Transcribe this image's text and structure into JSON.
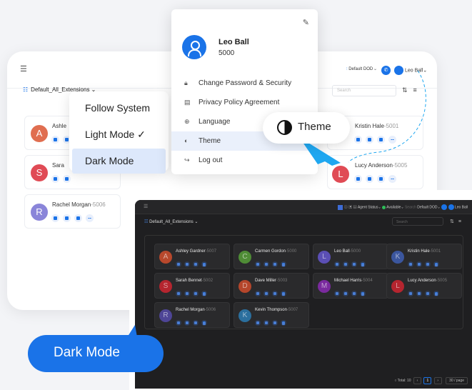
{
  "colors": {
    "accent": "#1a73e8",
    "dark_bg": "#1f1f21",
    "light_bg": "#ffffff",
    "status_green": "#2ebd59"
  },
  "light_window": {
    "menu_icon": "menu-icon",
    "search_top_placeholder": "Search",
    "dod": "Default DOD",
    "user": "Leo Ball",
    "extension_group": "Default_All_Extensions",
    "search_placeholder": "Search",
    "cards": [
      {
        "initial": "A",
        "name": "Ashle",
        "ext": "",
        "color": "#e06e50"
      },
      {
        "initial": "S",
        "name": "Sara",
        "ext": "",
        "color": "#e04b55"
      },
      {
        "initial": "R",
        "name": "Rachel Morgan",
        "ext": "-5006",
        "color": "#8a85d9"
      },
      {
        "initial": "",
        "name": "Kristin Hale",
        "ext": "-5001",
        "color": "#7b8ee6"
      },
      {
        "initial": "L",
        "name": "Lucy Anderson",
        "ext": "-5005",
        "color": "#e04b55"
      }
    ]
  },
  "theme_menu": {
    "items": [
      "Follow System",
      "Light Mode ✓",
      "Dark Mode"
    ],
    "selected_index": 2
  },
  "profile_menu": {
    "name": "Leo Ball",
    "number": "5000",
    "items": [
      {
        "label": "Change Password & Security",
        "icon": "lock-icon"
      },
      {
        "label": "Privacy Policy Agreement",
        "icon": "document-icon"
      },
      {
        "label": "Language",
        "icon": "globe-icon"
      },
      {
        "label": "Theme",
        "icon": "theme-icon"
      },
      {
        "label": "Log out",
        "icon": "logout-icon"
      }
    ],
    "selected_index": 3
  },
  "theme_bubble": {
    "label": "Theme"
  },
  "dark_window": {
    "agent_status": "Agent Status",
    "available": "Available",
    "search_top_placeholder": "Search",
    "dod": "Default DOD",
    "user": "Leo Ball",
    "extension_group": "Default_All_Extensions",
    "search_placeholder": "Search",
    "cards": [
      {
        "initial": "A",
        "name": "Ashley Gardner",
        "ext": "-5007",
        "color": "#b8482c"
      },
      {
        "initial": "C",
        "name": "Carmen Gordon",
        "ext": "-5000",
        "color": "#4f8c36"
      },
      {
        "initial": "L",
        "name": "Leo Ball",
        "ext": "-5000",
        "color": "#5b4fb5"
      },
      {
        "initial": "K",
        "name": "Kristin Hale",
        "ext": "-5001",
        "color": "#3b569e"
      },
      {
        "initial": "S",
        "name": "Sarah Bennet",
        "ext": "-5002",
        "color": "#b5252f"
      },
      {
        "initial": "D",
        "name": "Dave Miller",
        "ext": "-5003",
        "color": "#b5462b"
      },
      {
        "initial": "M",
        "name": "Michael Harris",
        "ext": "-5004",
        "color": "#7a2a9e"
      },
      {
        "initial": "L",
        "name": "Lucy Anderson",
        "ext": "-5005",
        "color": "#b5252f"
      },
      {
        "initial": "R",
        "name": "Rachel Morgan",
        "ext": "-5006",
        "color": "#4e4596"
      },
      {
        "initial": "K",
        "name": "Kevin Thompson",
        "ext": "-5007",
        "color": "#2b6f9e"
      }
    ],
    "footer": {
      "total": "Total: 10",
      "page": "1",
      "page_size": "30 / page"
    }
  },
  "dark_mode_bubble": {
    "label": "Dark Mode"
  }
}
